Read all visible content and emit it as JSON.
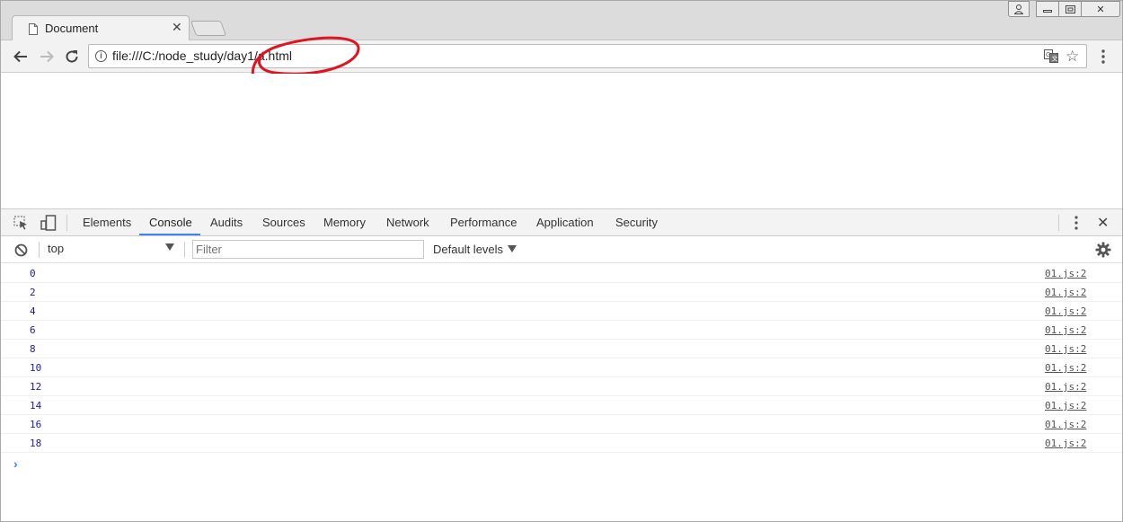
{
  "tab": {
    "title": "Document",
    "close": "✕"
  },
  "window_controls": {
    "user": "👤",
    "minimize": "▬",
    "maximize": "▣",
    "close": "✕"
  },
  "toolbar": {
    "url": "file:///C:/node_study/day1/a.html",
    "info": "i",
    "star": "☆"
  },
  "devtools": {
    "tabs": [
      "Elements",
      "Console",
      "Audits",
      "Sources",
      "Memory",
      "Network",
      "Performance",
      "Application",
      "Security"
    ],
    "active_tab": "Console",
    "close": "✕",
    "context": "top",
    "filter_placeholder": "Filter",
    "levels": "Default levels",
    "prompt": "›"
  },
  "console_logs": [
    {
      "value": "0",
      "source": "01.js:2"
    },
    {
      "value": "2",
      "source": "01.js:2"
    },
    {
      "value": "4",
      "source": "01.js:2"
    },
    {
      "value": "6",
      "source": "01.js:2"
    },
    {
      "value": "8",
      "source": "01.js:2"
    },
    {
      "value": "10",
      "source": "01.js:2"
    },
    {
      "value": "12",
      "source": "01.js:2"
    },
    {
      "value": "14",
      "source": "01.js:2"
    },
    {
      "value": "16",
      "source": "01.js:2"
    },
    {
      "value": "18",
      "source": "01.js:2"
    }
  ],
  "colors": {
    "accent": "#3e82f7",
    "log_value": "#1a1aa6",
    "annotation": "#e0141e"
  }
}
